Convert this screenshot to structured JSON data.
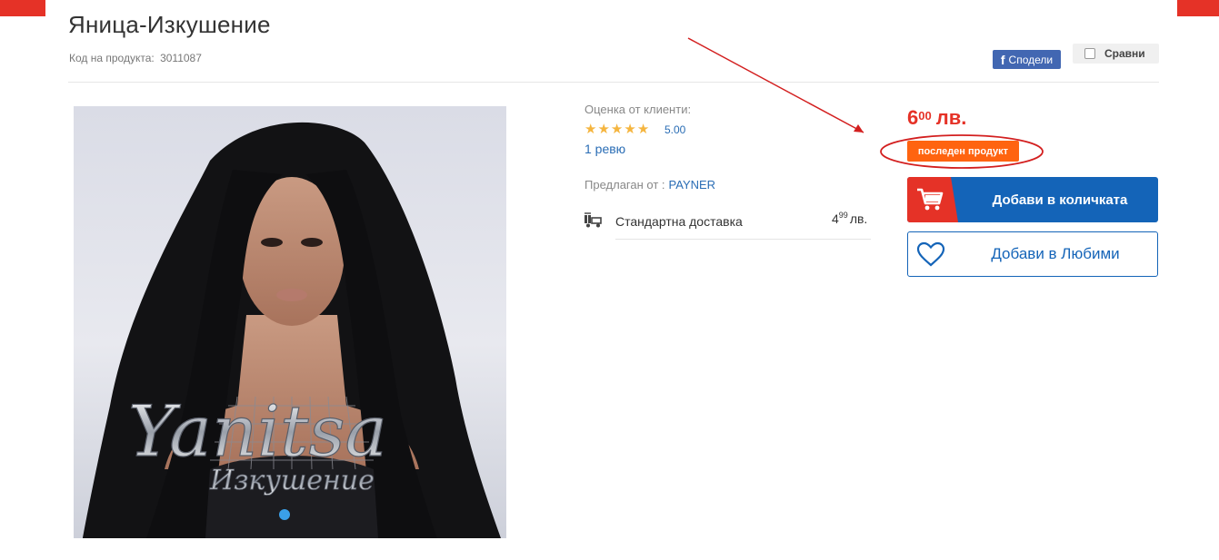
{
  "product": {
    "title": "Яница-Изкушение",
    "code_label": "Код на продукта:",
    "code_value": "3011087",
    "image_text_1": "Yanitsa",
    "image_text_2": "Изкушение"
  },
  "share": {
    "label": "Сподели",
    "icon": "facebook-icon"
  },
  "compare": {
    "label": "Сравни",
    "checked": false
  },
  "rating": {
    "label": "Оценка от клиенти:",
    "stars": [
      "★",
      "★",
      "★",
      "★",
      "★"
    ],
    "value": "5.00",
    "reviews_link": "1 ревю"
  },
  "seller": {
    "label": "Предлаган от :",
    "name": "PAYNER"
  },
  "delivery": {
    "label": "Стандартна доставка",
    "price_int": "4",
    "price_dec": "99",
    "currency": "лв.",
    "icon": "delivery-truck-icon"
  },
  "price": {
    "int": "6",
    "dec": "00",
    "currency": "лв."
  },
  "badge": {
    "label": "последен продукт"
  },
  "cart_button": {
    "label": "Добави в количката",
    "icon": "cart-icon"
  },
  "favorites_button": {
    "label": "Добави в Любими",
    "icon": "heart-icon"
  },
  "colors": {
    "accent_red": "#e53227",
    "brand_blue": "#1464b8",
    "badge_orange": "#ff6410",
    "star_yellow": "#f5b53f",
    "facebook_blue": "#4267b2"
  }
}
